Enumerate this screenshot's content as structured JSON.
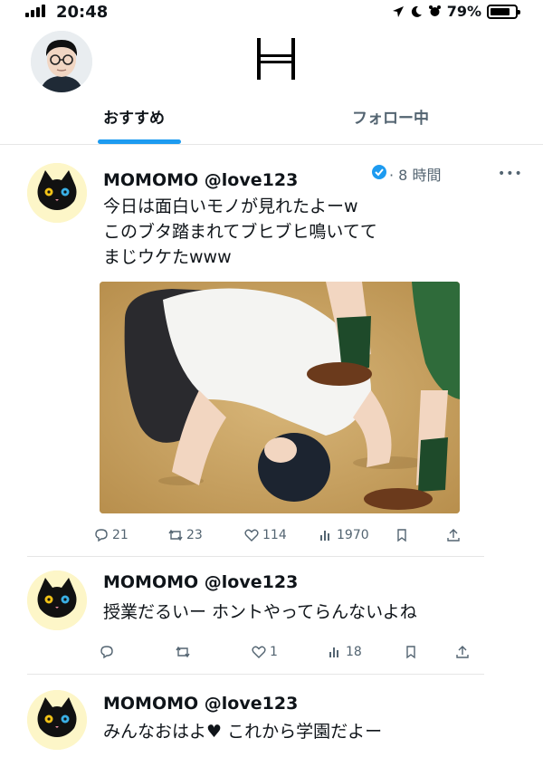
{
  "status_bar": {
    "time": "20:48",
    "battery": "79%",
    "icons": [
      "signal-icon",
      "location-arrow-icon",
      "moon-icon",
      "alarm-icon",
      "battery-icon"
    ]
  },
  "header": {
    "logo": "H"
  },
  "tabs": [
    {
      "label": "おすすめ",
      "active": true
    },
    {
      "label": "フォロー中",
      "active": false
    }
  ],
  "colors": {
    "accent": "#1d9bf0",
    "muted": "#536471",
    "text": "#0f1419"
  },
  "tweets": [
    {
      "name": "MOMOMO @love123",
      "time": "· 8 時間",
      "lines": [
        "今日は面白いモノが見れたよーw",
        "このブタ踏まれてブヒブヒ鳴いてて",
        "まじウケたwww"
      ],
      "actions": {
        "replies": "21",
        "retweets": "23",
        "likes": "114",
        "views": "1970"
      }
    },
    {
      "name": "MOMOMO @love123",
      "lines": [
        "授業だるいー ホントやってらんないよね"
      ],
      "actions": {
        "replies": "",
        "retweets": "",
        "likes": "1",
        "views": "18"
      }
    },
    {
      "name": "MOMOMO @love123",
      "lines": [
        "みんなおはよ♥ これから学園だよー"
      ]
    }
  ]
}
